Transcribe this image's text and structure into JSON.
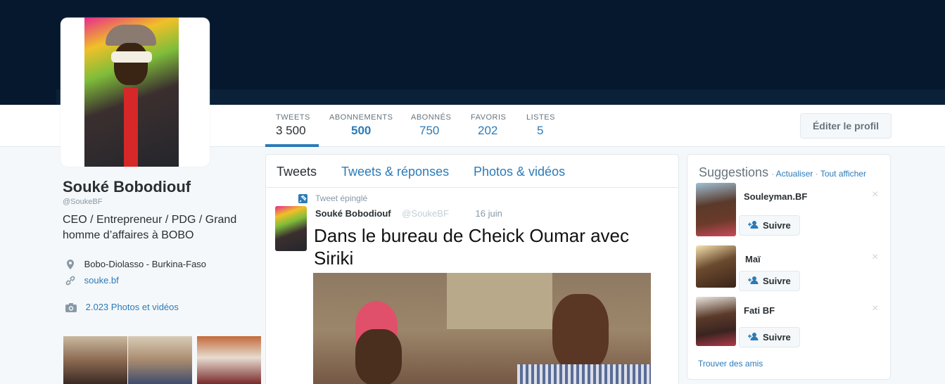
{
  "colors": {
    "link": "#2b7bb9",
    "banner": "#06182e",
    "text": "#292f33",
    "muted": "#8899a6"
  },
  "nav": {
    "stats": [
      {
        "label": "TWEETS",
        "value": "3 500"
      },
      {
        "label": "ABONNEMENTS",
        "value": "500"
      },
      {
        "label": "ABONNÉS",
        "value": "750"
      },
      {
        "label": "FAVORIS",
        "value": "202"
      },
      {
        "label": "LISTES",
        "value": "5"
      }
    ],
    "edit_profile": "Éditer le profil"
  },
  "profile": {
    "name": "Souké Bobodiouf",
    "handle": "@SoukeBF",
    "bio": "CEO / Entrepreneur / PDG / Grand homme d’affaires à BOBO",
    "location": "Bobo-Diolasso - Burkina-Faso",
    "website": "souke.bf",
    "media_count": "2.023 Photos et vidéos"
  },
  "timeline": {
    "tabs": [
      "Tweets",
      "Tweets & réponses",
      "Photos & vidéos"
    ],
    "pinned_label": "Tweet épinglé",
    "tweet": {
      "author": "Souké Bobodiouf",
      "handle": "@SoukeBF",
      "date": "16 juin",
      "text": "Dans le bureau de Cheick Oumar avec Siriki"
    }
  },
  "suggestions": {
    "title": "Suggestions",
    "separator": "·",
    "refresh": "Actualiser",
    "view_all": "Tout afficher",
    "follow_label": "Suivre",
    "close_symbol": "×",
    "items": [
      {
        "name": "Souleyman.BF"
      },
      {
        "name": "Maï"
      },
      {
        "name": "Fati BF"
      }
    ],
    "find_friends": "Trouver des amis"
  },
  "icons": {
    "location": "map-pin-icon",
    "website": "link-icon",
    "media": "camera-icon",
    "pin": "pin-icon",
    "follow": "add-person-icon",
    "close": "close-icon"
  }
}
